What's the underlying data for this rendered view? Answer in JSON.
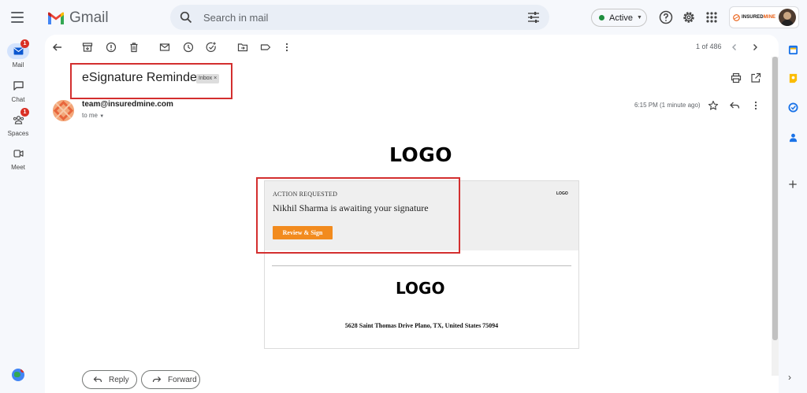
{
  "app": {
    "name": "Gmail"
  },
  "search": {
    "placeholder": "Search in mail"
  },
  "status": {
    "label": "Active",
    "color": "#1e8e3e"
  },
  "brand": {
    "prefix": "INSURED",
    "suffix": "MINE"
  },
  "nav": {
    "items": [
      {
        "label": "Mail",
        "badge": "1",
        "selected": true
      },
      {
        "label": "Chat"
      },
      {
        "label": "Spaces",
        "badge": "1"
      },
      {
        "label": "Meet"
      }
    ]
  },
  "toolbar": {
    "pager": "1 of 486"
  },
  "message": {
    "subject": "eSignature Reminder",
    "label": "Inbox ×",
    "sender": "team@insuredmine.com",
    "recipient": "to me",
    "time": "6:15 PM (1 minute ago)"
  },
  "email": {
    "logo_top": "LOGO",
    "action_requested": "ACTION REQUESTED",
    "awaiting": "Nikhil Sharma is awaiting your signature",
    "button": "Review & Sign",
    "mini_logo": "LOGO",
    "logo_footer": "LOGO",
    "address": "5628 Saint Thomas Drive Plano, TX, United States 75094",
    "button_color": "#f28b1e"
  },
  "actions": {
    "reply": "Reply",
    "forward": "Forward"
  },
  "colors": {
    "highlight": "#d32f2f",
    "accent": "#0b57d0"
  }
}
